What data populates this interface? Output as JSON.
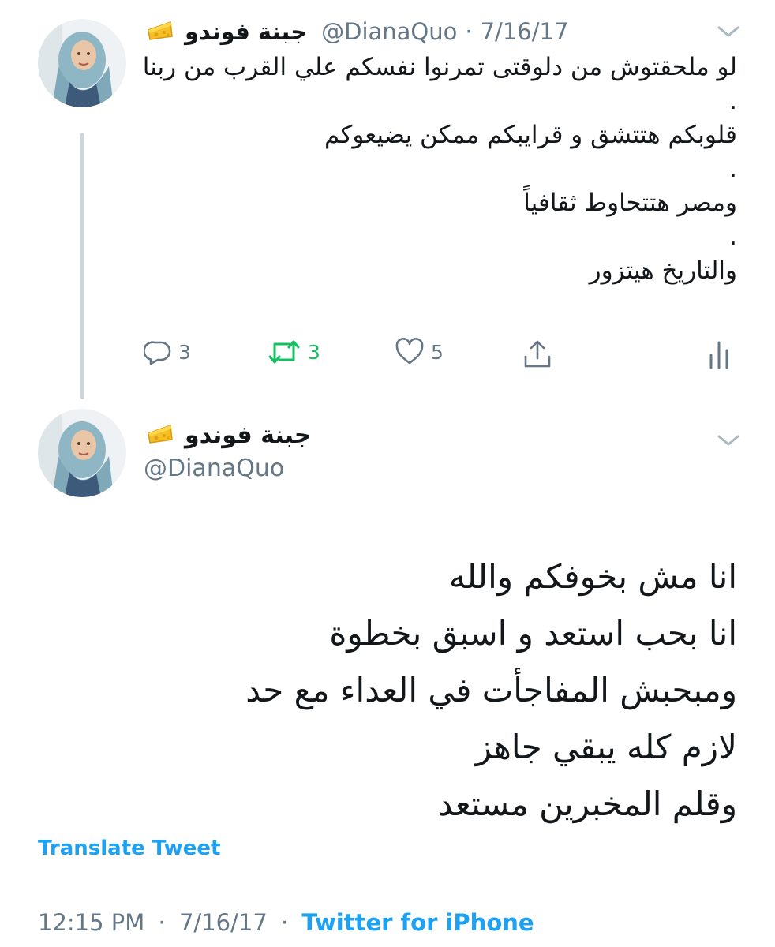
{
  "tweet1": {
    "display_name": "جبنة فوندو",
    "emoji_icon": "cheese-icon",
    "handle": "@DianaQuo",
    "separator": "·",
    "date": "7/16/17",
    "text_lines": [
      "لو ملحقتوش من دلوقتى تمرنوا نفسكم علي القرب من ربنا",
      ".",
      "قلوبكم هتتشق و قرايبكم ممكن يضيعوكم",
      ".",
      "ومصر هتتحاوط ثقافياً",
      ".",
      "والتاريخ هيتزور"
    ],
    "actions": {
      "reply_count": "3",
      "retweet_count": "3",
      "like_count": "5"
    }
  },
  "tweet2": {
    "display_name": "جبنة فوندو",
    "emoji_icon": "cheese-icon",
    "handle": "@DianaQuo",
    "text_lines": [
      "انا مش بخوفكم والله",
      "انا بحب استعد و اسبق بخطوة",
      "ومبحبش المفاجأت في العداء مع حد",
      "لازم كله يبقي جاهز",
      "وقلم المخبرين مستعد"
    ],
    "translate_label": "Translate Tweet",
    "time": "12:15 PM",
    "separator": "·",
    "date": "7/16/17",
    "source": "Twitter for iPhone"
  },
  "colors": {
    "accent": "#1da1f2",
    "retweet": "#17bf63",
    "secondary_text": "#657786",
    "thread_line": "#ccd6dd"
  }
}
